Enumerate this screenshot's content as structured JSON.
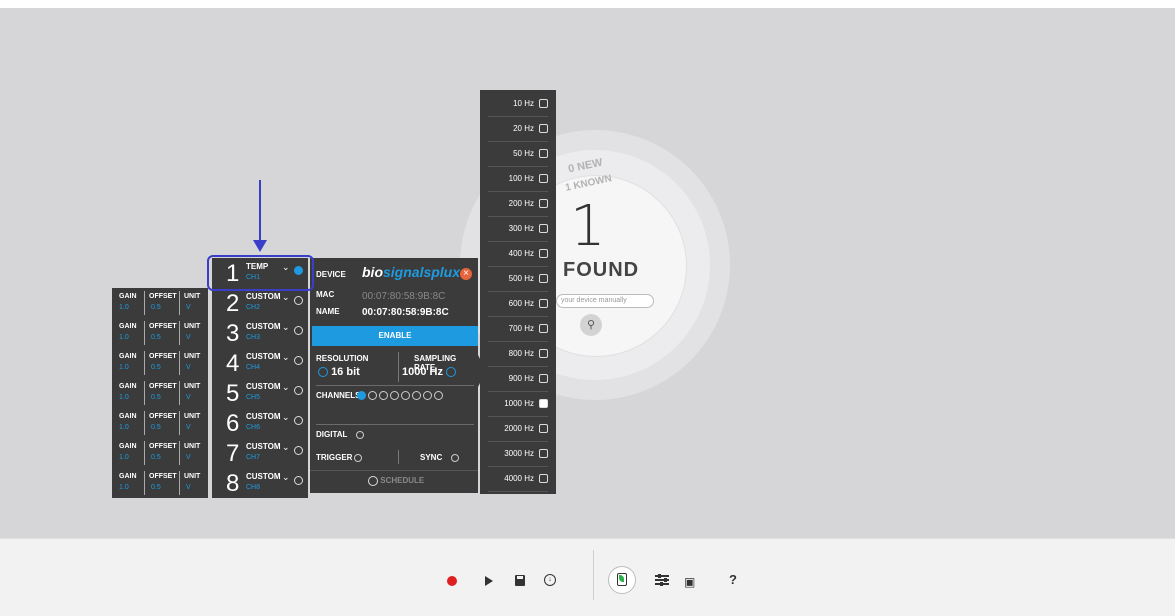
{
  "background": {
    "new_count": "0 NEW",
    "known_count": "1 KNOWN",
    "found_count": "1",
    "found_label": "FOUND",
    "search_placeholder": "your device manually"
  },
  "channels": [
    {
      "num": "1",
      "type": "TEMP",
      "ch": "CH1",
      "selected": true,
      "gain_label": "",
      "gain": "",
      "offset_label": "",
      "offset": "",
      "unit_label": "",
      "unit": ""
    },
    {
      "num": "2",
      "type": "CUSTOM",
      "ch": "CH2",
      "selected": false,
      "gain_label": "GAIN",
      "gain": "1.0",
      "offset_label": "OFFSET",
      "offset": "0.5",
      "unit_label": "UNIT",
      "unit": "V"
    },
    {
      "num": "3",
      "type": "CUSTOM",
      "ch": "CH3",
      "selected": false,
      "gain_label": "GAIN",
      "gain": "1.0",
      "offset_label": "OFFSET",
      "offset": "0.5",
      "unit_label": "UNIT",
      "unit": "V"
    },
    {
      "num": "4",
      "type": "CUSTOM",
      "ch": "CH4",
      "selected": false,
      "gain_label": "GAIN",
      "gain": "1.0",
      "offset_label": "OFFSET",
      "offset": "0.5",
      "unit_label": "UNIT",
      "unit": "V"
    },
    {
      "num": "5",
      "type": "CUSTOM",
      "ch": "CH5",
      "selected": false,
      "gain_label": "GAIN",
      "gain": "1.0",
      "offset_label": "OFFSET",
      "offset": "0.5",
      "unit_label": "UNIT",
      "unit": "V"
    },
    {
      "num": "6",
      "type": "CUSTOM",
      "ch": "CH6",
      "selected": false,
      "gain_label": "GAIN",
      "gain": "1.0",
      "offset_label": "OFFSET",
      "offset": "0.5",
      "unit_label": "UNIT",
      "unit": "V"
    },
    {
      "num": "7",
      "type": "CUSTOM",
      "ch": "CH7",
      "selected": false,
      "gain_label": "GAIN",
      "gain": "1.0",
      "offset_label": "OFFSET",
      "offset": "0.5",
      "unit_label": "UNIT",
      "unit": "V"
    },
    {
      "num": "8",
      "type": "CUSTOM",
      "ch": "CH8",
      "selected": false,
      "gain_label": "GAIN",
      "gain": "1.0",
      "offset_label": "OFFSET",
      "offset": "0.5",
      "unit_label": "UNIT",
      "unit": "V"
    }
  ],
  "device": {
    "device_label": "DEVICE",
    "logo_part1": "bio",
    "logo_part2": "signalsplux",
    "mac_label": "MAC",
    "mac_value": "00:07:80:58:9B:8C",
    "name_label": "NAME",
    "name_value": "00:07:80:58:9B:8C",
    "enable_label": "ENABLE",
    "resolution_label": "RESOLUTION",
    "resolution_value": "16 bit",
    "sampling_label": "SAMPLING RATE",
    "sampling_value": "1000 Hz",
    "channels_label": "CHANNELS",
    "digital_label": "DIGITAL",
    "trigger_label": "TRIGGER",
    "sync_label": "SYNC",
    "schedule_label": "SCHEDULE"
  },
  "frequencies": [
    {
      "label": "10 Hz",
      "checked": false
    },
    {
      "label": "20 Hz",
      "checked": false
    },
    {
      "label": "50 Hz",
      "checked": false
    },
    {
      "label": "100 Hz",
      "checked": false
    },
    {
      "label": "200 Hz",
      "checked": false
    },
    {
      "label": "300 Hz",
      "checked": false
    },
    {
      "label": "400 Hz",
      "checked": false
    },
    {
      "label": "500 Hz",
      "checked": false
    },
    {
      "label": "600 Hz",
      "checked": false
    },
    {
      "label": "700 Hz",
      "checked": false
    },
    {
      "label": "800 Hz",
      "checked": false
    },
    {
      "label": "900 Hz",
      "checked": false
    },
    {
      "label": "1000 Hz",
      "checked": true
    },
    {
      "label": "2000 Hz",
      "checked": false
    },
    {
      "label": "3000 Hz",
      "checked": false
    },
    {
      "label": "4000 Hz",
      "checked": false
    }
  ],
  "toolbar": {
    "record_icon": "record-icon",
    "play_icon": "play-icon",
    "save_icon": "save-icon",
    "download_icon": "download-icon",
    "device_icon": "device-icon",
    "settings_icon": "sliders-icon",
    "cart_icon": "cart-icon",
    "help_label": "?"
  },
  "colors": {
    "accent": "#1e9be0",
    "panel": "#3b3b3b",
    "record": "#e02020",
    "highlight": "#3a3ec8",
    "close": "#e8643c"
  }
}
